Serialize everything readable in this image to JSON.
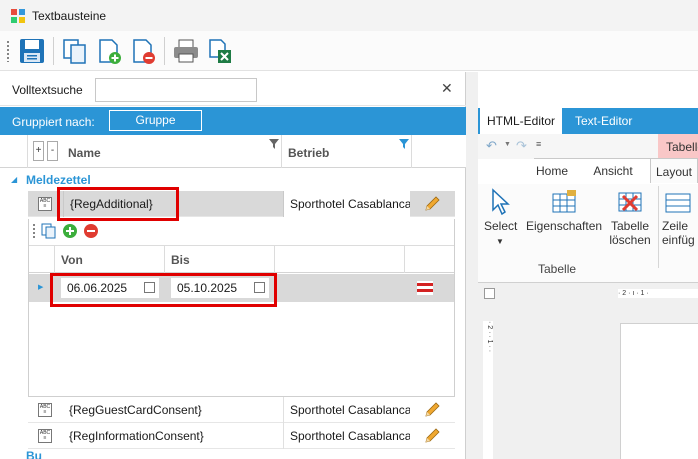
{
  "window": {
    "title": "Textbausteine"
  },
  "toolbar": {
    "buttons": [
      {
        "icon": "save-icon"
      },
      {
        "icon": "copy-documents-icon"
      },
      {
        "icon": "new-document-icon"
      },
      {
        "icon": "delete-document-icon"
      },
      {
        "icon": "print-icon"
      },
      {
        "icon": "excel-export-icon"
      }
    ]
  },
  "search": {
    "label": "Volltextsuche",
    "value": "",
    "placeholder": ""
  },
  "grouping": {
    "label": "Gruppiert nach:",
    "button": "Gruppe"
  },
  "grid": {
    "plus": "+",
    "minus": "-",
    "columns": {
      "name": "Name",
      "betrieb": "Betrieb"
    },
    "group": "Meldezettel",
    "rows": [
      {
        "name": "{RegAdditional}",
        "betrieb": "Sporthotel Casablanca'"
      },
      {
        "name": "{RegGuestCardConsent}",
        "betrieb": "Sporthotel Casablanca'"
      },
      {
        "name": "{RegInformationConsent}",
        "betrieb": "Sporthotel Casablanca'"
      }
    ],
    "next_group": "Bu"
  },
  "detail": {
    "columns": {
      "von": "Von",
      "bis": "Bis"
    },
    "row": {
      "von": "06.06.2025",
      "bis": "05.10.2025"
    }
  },
  "editor": {
    "tabs": [
      "HTML-Editor",
      "Text-Editor"
    ],
    "table_tab": "Tabelle",
    "ribbon_tabs": [
      "Home",
      "Ansicht",
      "Layout"
    ],
    "actions": {
      "select": "Select",
      "properties": "Eigenschaften",
      "delete_table_1": "Tabelle",
      "delete_table_2": "löschen",
      "insert_row_1": "Zeile",
      "insert_row_2": "einfüg"
    },
    "group_label": "Tabelle",
    "ruler_top": "· 2 · ı · 1 ·",
    "ruler_side": "· 2 · · 1 · ·"
  },
  "colors": {
    "accent": "#2b95d6",
    "highlight": "#e00000",
    "selection": "#d9d9d9"
  }
}
